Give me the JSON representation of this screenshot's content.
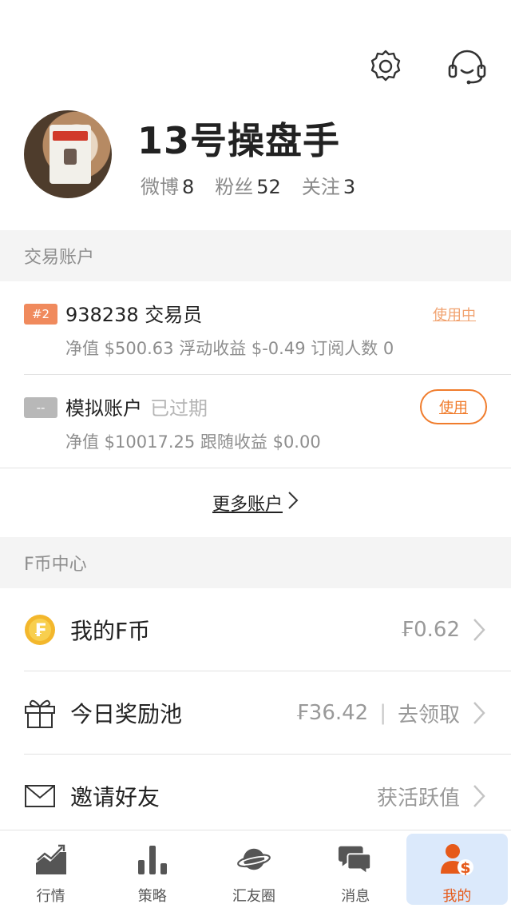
{
  "header": {
    "settings_icon": "gear-icon",
    "support_icon": "headset-icon"
  },
  "profile": {
    "name": "13号操盘手",
    "stats": [
      {
        "label": "微博",
        "value": "8"
      },
      {
        "label": "粉丝",
        "value": "52"
      },
      {
        "label": "关注",
        "value": "3"
      }
    ]
  },
  "accounts_section": {
    "header": "交易账户",
    "accounts": [
      {
        "badge": "#2",
        "badge_color": "#f08a5d",
        "name": "938238 交易员",
        "expired": "",
        "summary": "净值 $500.63  浮动收益 $-0.49  订阅人数 0",
        "status": "使用中"
      },
      {
        "badge": "--",
        "badge_color": "#b8b8b8",
        "name": "模拟账户",
        "expired": "已过期",
        "summary": "净值 $10017.25  跟随收益 $0.00",
        "action": "使用"
      }
    ],
    "more": "更多账户"
  },
  "fcoin_section": {
    "header": "F币中心",
    "rows": [
      {
        "icon": "coin-icon",
        "label": "我的F币",
        "value": "₣0.62"
      },
      {
        "icon": "gift-icon",
        "label": "今日奖励池",
        "value": "₣36.42",
        "separator": "|",
        "action": "去领取"
      },
      {
        "icon": "envelope-icon",
        "label": "邀请好友",
        "value": "获活跃值"
      }
    ]
  },
  "tabbar": {
    "tabs": [
      {
        "label": "行情",
        "icon": "market-chart-icon"
      },
      {
        "label": "策略",
        "icon": "bar-chart-icon"
      },
      {
        "label": "汇友圈",
        "icon": "planet-icon"
      },
      {
        "label": "消息",
        "icon": "chat-bubbles-icon"
      },
      {
        "label": "我的",
        "icon": "user-dollar-icon",
        "active": true
      }
    ]
  },
  "colors": {
    "accent": "#f07c2c",
    "active_tab_bg": "#dbe9fb"
  }
}
